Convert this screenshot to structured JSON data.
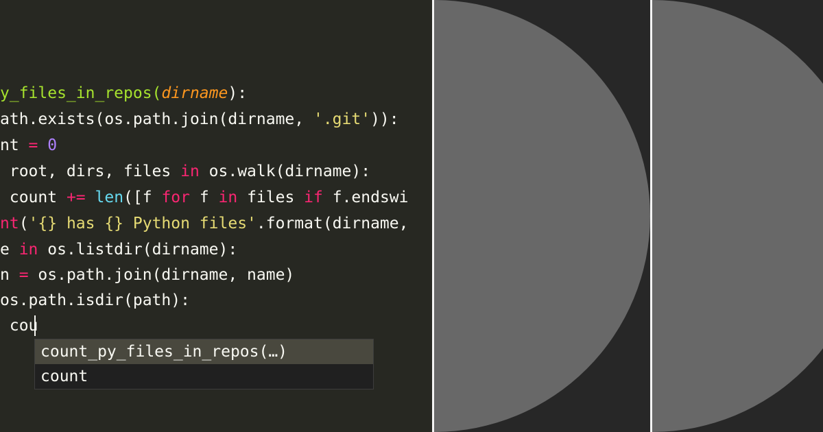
{
  "editor": {
    "lines": [
      [
        {
          "t": "y_files_in_repos(",
          "c": "#a6e22e"
        },
        {
          "t": "dirname",
          "c": "#fd971f",
          "i": true
        },
        {
          "t": "):",
          "c": "#f8f8f2"
        }
      ],
      [
        {
          "t": "ath.exists(os.path.join(dirname, ",
          "c": "#f8f8f2"
        },
        {
          "t": "'.git'",
          "c": "#e6db74"
        },
        {
          "t": ")):",
          "c": "#f8f8f2"
        }
      ],
      [
        {
          "t": "nt ",
          "c": "#f8f8f2"
        },
        {
          "t": "=",
          "c": "#f92672"
        },
        {
          "t": " ",
          "c": "#f8f8f2"
        },
        {
          "t": "0",
          "c": "#ae81ff"
        }
      ],
      [
        {
          "t": " root, dirs, files ",
          "c": "#f8f8f2"
        },
        {
          "t": "in",
          "c": "#f92672"
        },
        {
          "t": " os.walk(dirname):",
          "c": "#f8f8f2"
        }
      ],
      [
        {
          "t": " count ",
          "c": "#f8f8f2"
        },
        {
          "t": "+=",
          "c": "#f92672"
        },
        {
          "t": " ",
          "c": "#f8f8f2"
        },
        {
          "t": "len",
          "c": "#66d9ef"
        },
        {
          "t": "([f ",
          "c": "#f8f8f2"
        },
        {
          "t": "for",
          "c": "#f92672"
        },
        {
          "t": " f ",
          "c": "#f8f8f2"
        },
        {
          "t": "in",
          "c": "#f92672"
        },
        {
          "t": " files ",
          "c": "#f8f8f2"
        },
        {
          "t": "if",
          "c": "#f92672"
        },
        {
          "t": " f.endswi",
          "c": "#f8f8f2"
        }
      ],
      [
        {
          "t": "nt",
          "c": "#f92672"
        },
        {
          "t": "(",
          "c": "#f8f8f2"
        },
        {
          "t": "'{} has {} Python files'",
          "c": "#e6db74"
        },
        {
          "t": ".format(dirname,",
          "c": "#f8f8f2"
        }
      ],
      [
        {
          "t": "e ",
          "c": "#f8f8f2"
        },
        {
          "t": "in",
          "c": "#f92672"
        },
        {
          "t": " os.listdir(dirname):",
          "c": "#f8f8f2"
        }
      ],
      [
        {
          "t": "n ",
          "c": "#f8f8f2"
        },
        {
          "t": "=",
          "c": "#f92672"
        },
        {
          "t": " os.path.join(dirname, name)",
          "c": "#f8f8f2"
        }
      ],
      [
        {
          "t": "os.path.isdir(path):",
          "c": "#f8f8f2"
        }
      ],
      [
        {
          "t": " cou",
          "c": "#f8f8f2"
        }
      ]
    ]
  },
  "autocomplete": {
    "items": [
      {
        "label": "count_py_files_in_repos(…)",
        "selected": true
      },
      {
        "label": "count",
        "selected": false
      }
    ]
  },
  "colors": {
    "editor_bg": "#272822",
    "panel_bg": "#272727",
    "shape_fill": "#686868",
    "divider": "#f4f4f4"
  }
}
